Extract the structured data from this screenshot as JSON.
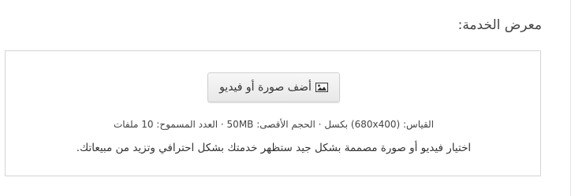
{
  "gallery": {
    "title": "معرض الخدمة:",
    "add_button_label": "أضف صورة أو فيديو",
    "add_button_icon": "image-icon",
    "specs": "القياس: (680x400) بكسل · الحجم الأقصى: 50MB · العدد المسموح: 10 ملفات",
    "hint": "اختيار فيديو أو صورة مصممة بشكل جيد ستظهر خدمتك بشكل احترافي وتزيد من مبيعاتك."
  },
  "colors": {
    "box_border": "#d4d4d4",
    "button_bg": "#efefef",
    "text": "#333333"
  }
}
